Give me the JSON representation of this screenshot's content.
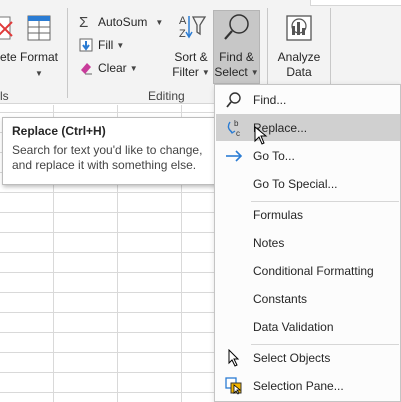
{
  "ribbon": {
    "cells_partial_left": "ete",
    "cells_partial_bottom": "ls",
    "format_label": "Format",
    "autosum_label": "AutoSum",
    "fill_label": "Fill",
    "clear_label": "Clear",
    "sort_filter_line1": "Sort &",
    "sort_filter_line2": "Filter",
    "find_select_line1": "Find &",
    "find_select_line2": "Select",
    "analyze_line1": "Analyze",
    "analyze_line2": "Data",
    "editing_group_label": "Editing"
  },
  "tooltip": {
    "title": "Replace (Ctrl+H)",
    "line1": "Search for text you'd like to change,",
    "line2": "and replace it with something else."
  },
  "menu": {
    "items": [
      {
        "label": "Find...",
        "icon": "search-icon"
      },
      {
        "label": "Replace...",
        "icon": "replace-icon",
        "highlighted": true
      },
      {
        "label": "Go To...",
        "icon": "arrow-right-icon"
      },
      {
        "label": "Go To Special...",
        "icon": ""
      },
      {
        "label": "Formulas",
        "icon": ""
      },
      {
        "label": "Notes",
        "icon": ""
      },
      {
        "label": "Conditional Formatting",
        "icon": ""
      },
      {
        "label": "Constants",
        "icon": ""
      },
      {
        "label": "Data Validation",
        "icon": ""
      },
      {
        "label": "Select Objects",
        "icon": "cursor-arrow-icon"
      },
      {
        "label": "Selection Pane...",
        "icon": "selection-pane-icon"
      }
    ]
  },
  "colors": {
    "accent_blue": "#2b7cd3",
    "delete_red": "#e03a3a",
    "eraser_pink": "#c83c9a",
    "menu_highlight": "#d0d0d0",
    "pressed_button": "#c7c7c7"
  }
}
